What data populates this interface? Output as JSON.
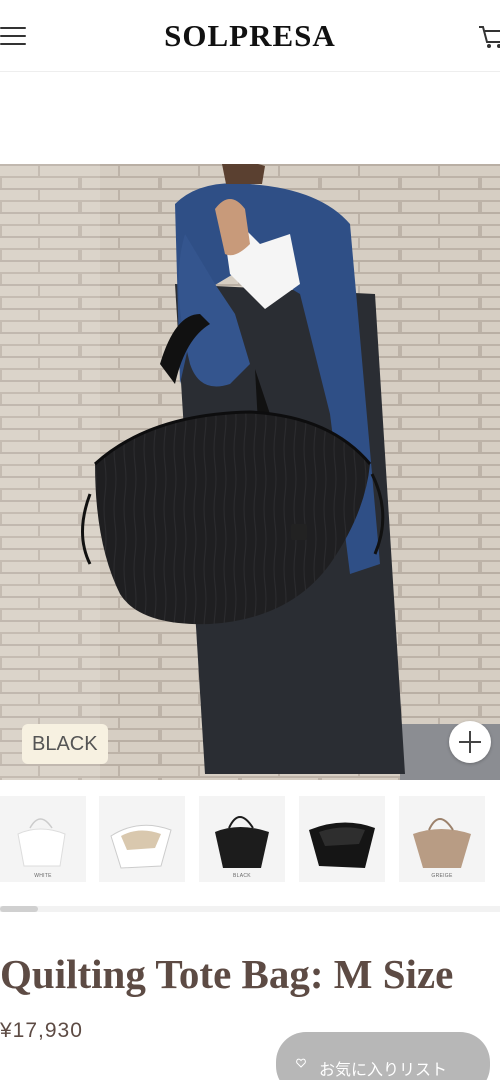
{
  "header": {
    "brand": "SOLPRESA",
    "menu_icon": "hamburger-menu-icon",
    "cart_icon": "shopping-cart-icon"
  },
  "hero": {
    "color_badge": "BLACK",
    "zoom_icon": "plus-icon"
  },
  "thumbnails": [
    {
      "label": "WHITE",
      "color": "#f2f2f0"
    },
    {
      "label": "",
      "color": "#f0ece6"
    },
    {
      "label": "BLACK",
      "color": "#1c1c1c"
    },
    {
      "label": "",
      "color": "#1c1c1c"
    },
    {
      "label": "GREIGE",
      "color": "#b89c84"
    }
  ],
  "product": {
    "title": "Quilting Tote Bag: M Size",
    "price": "¥17,930"
  },
  "favorite": {
    "label": "お気に入りリスト",
    "icon": "heart-icon"
  },
  "colors": {
    "title_text": "#5d4b44",
    "badge_bg": "#f7f1e1",
    "fav_button_bg": "#b7b7b7"
  }
}
